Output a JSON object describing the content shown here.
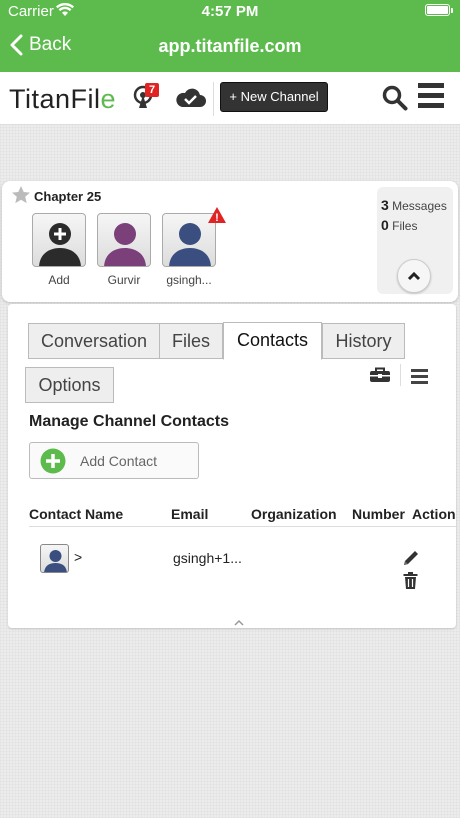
{
  "status": {
    "carrier": "Carrier",
    "time": "4:57 PM",
    "battery_level": 1.0
  },
  "nav": {
    "back_label": "Back",
    "url": "app.titanfile.com"
  },
  "header": {
    "logo_text": "TitanFil",
    "logo_suffix": "e",
    "notification_count": "7",
    "new_channel_label": "+ New Channel"
  },
  "channel": {
    "title": "Chapter 25",
    "members": [
      {
        "name": "Add",
        "icon": "add-user"
      },
      {
        "name": "Gurvir",
        "icon": "user-purple"
      },
      {
        "name": "gsingh...",
        "icon": "user-blue",
        "alert": "!"
      }
    ],
    "stats": {
      "messages_count": "3",
      "messages_label": "Messages",
      "files_count": "0",
      "files_label": "Files"
    }
  },
  "tabs": [
    {
      "label": "Conversation",
      "active": false
    },
    {
      "label": "Files",
      "active": false
    },
    {
      "label": "Contacts",
      "active": true
    },
    {
      "label": "History",
      "active": false
    },
    {
      "label": "Options",
      "active": false
    }
  ],
  "contacts": {
    "title": "Manage Channel Contacts",
    "add_label": "Add Contact",
    "columns": [
      "Contact Name",
      "Email",
      "Organization",
      "Number",
      "Action"
    ],
    "rows": [
      {
        "name": ">",
        "email": "gsingh+1...",
        "organization": "",
        "number": ""
      }
    ]
  },
  "colors": {
    "brand_green": "#5dbb4e",
    "badge_red": "#e02424"
  }
}
